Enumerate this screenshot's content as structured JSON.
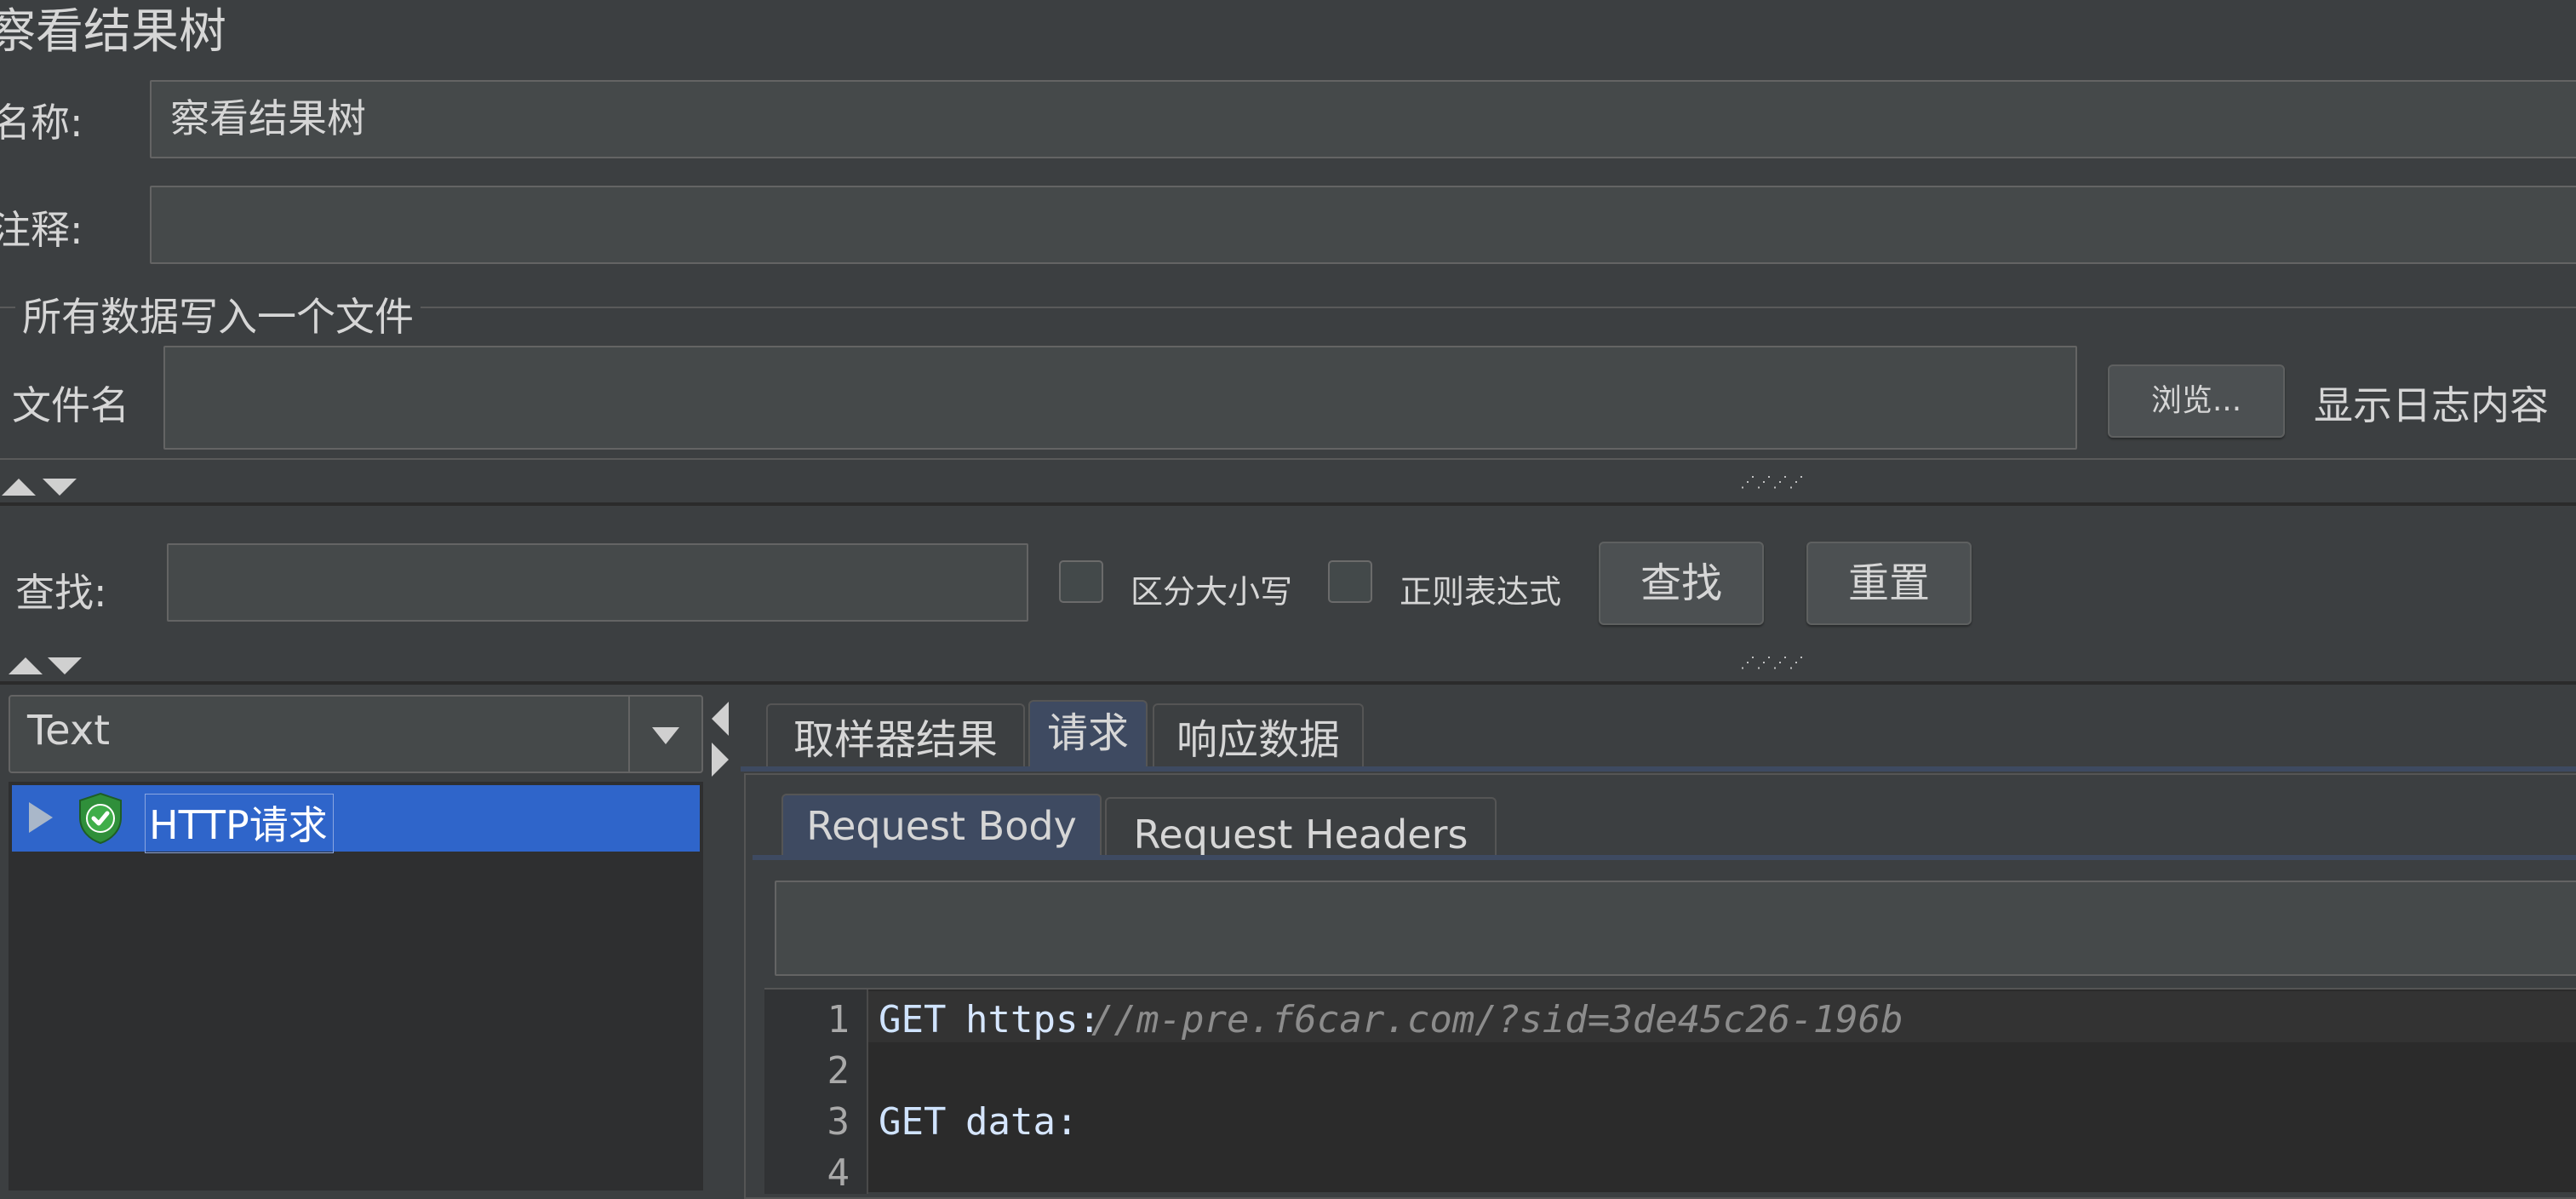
{
  "panel_title": "察看结果树",
  "name_label": "名称:",
  "name_value": "察看结果树",
  "comment_label": "注释:",
  "comment_value": "",
  "file_section": {
    "title": "所有数据写入一个文件",
    "filename_label": "文件名",
    "filename_value": "",
    "browse_label": "浏览...",
    "log_label": "显示日志内容"
  },
  "search": {
    "label": "查找:",
    "value": "",
    "case_label": "区分大小写",
    "case_checked": false,
    "regex_label": "正则表达式",
    "regex_checked": false,
    "find_label": "查找",
    "reset_label": "重置"
  },
  "grip_text": "⋰⋰⋰⋰",
  "renderer_select": {
    "selected": "Text"
  },
  "tree": {
    "items": [
      {
        "label": "HTTP请求",
        "status": "success",
        "selected": true
      }
    ]
  },
  "result_tabs": [
    "取样器结果",
    "请求",
    "响应数据"
  ],
  "active_result_tab": "请求",
  "request_tabs": [
    "Request Body",
    "Request Headers"
  ],
  "active_request_tab": "Request Body",
  "editor": {
    "lines": [
      {
        "num": "1",
        "keyword": "GET",
        "text": "https:",
        "rest": "//m-pre.f6car.com/?sid=3de45c26-196b"
      },
      {
        "num": "2",
        "keyword": "",
        "text": "",
        "rest": ""
      },
      {
        "num": "3",
        "keyword": "GET",
        "text": "data:",
        "rest": ""
      },
      {
        "num": "4",
        "keyword": "",
        "text": "",
        "rest": ""
      }
    ]
  },
  "colors": {
    "background": "#3c3f41",
    "selection": "#2f65ca",
    "success_green": "#3fae49",
    "active_tab": "#3e4a61"
  }
}
